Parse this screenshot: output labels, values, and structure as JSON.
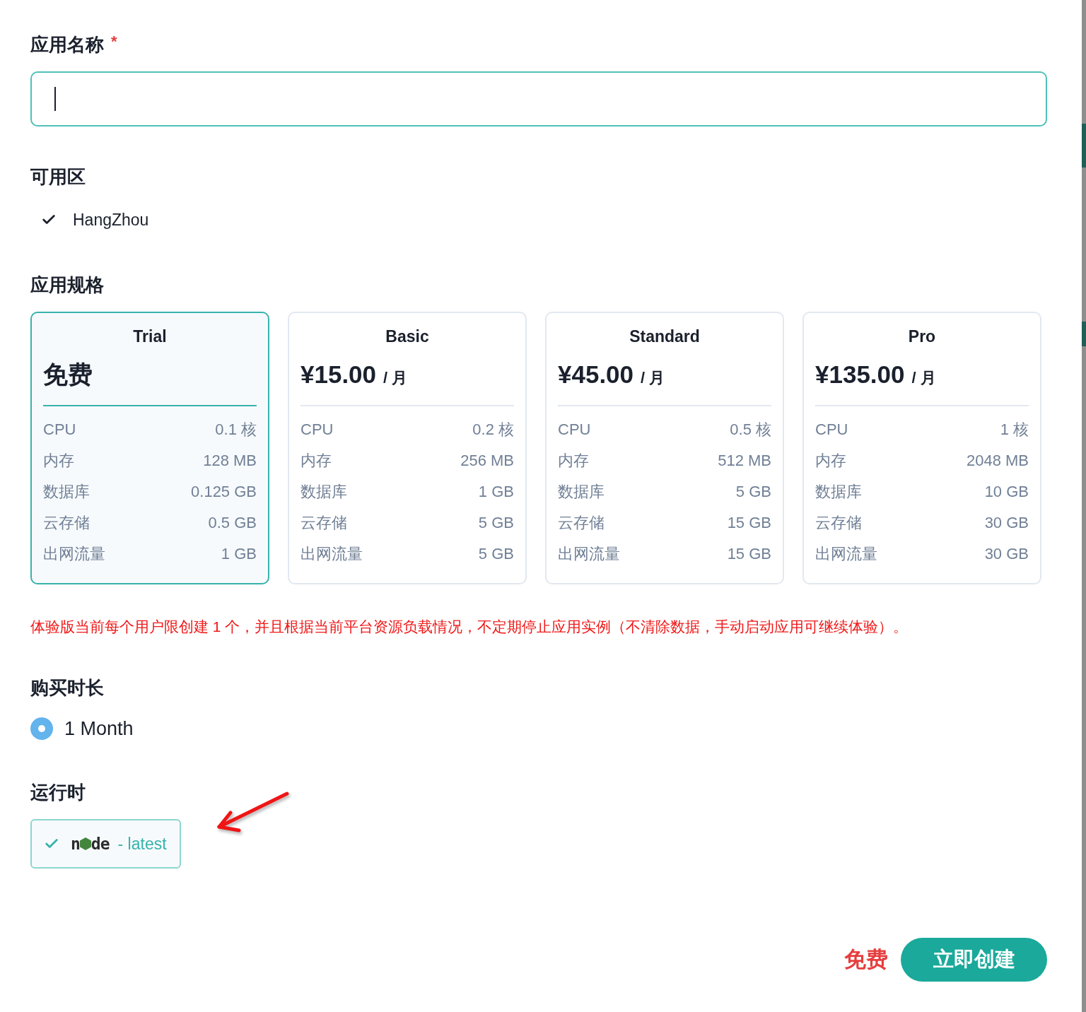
{
  "name_field": {
    "label": "应用名称",
    "required_mark": "*",
    "focused": true
  },
  "zone": {
    "label": "可用区",
    "options": [
      {
        "name": "HangZhou",
        "selected": true
      }
    ]
  },
  "plan": {
    "label": "应用规格",
    "plans": [
      {
        "name": "Trial",
        "price": "免费",
        "selected": true,
        "specs": [
          {
            "label": "CPU",
            "value": "0.1 核"
          },
          {
            "label": "内存",
            "value": "128 MB"
          },
          {
            "label": "数据库",
            "value": "0.125 GB"
          },
          {
            "label": "云存储",
            "value": "0.5 GB"
          },
          {
            "label": "出网流量",
            "value": "1 GB"
          }
        ]
      },
      {
        "name": "Basic",
        "price": "¥15.00",
        "unit": "/ 月",
        "selected": false,
        "specs": [
          {
            "label": "CPU",
            "value": "0.2 核"
          },
          {
            "label": "内存",
            "value": "256 MB"
          },
          {
            "label": "数据库",
            "value": "1 GB"
          },
          {
            "label": "云存储",
            "value": "5 GB"
          },
          {
            "label": "出网流量",
            "value": "5 GB"
          }
        ]
      },
      {
        "name": "Standard",
        "price": "¥45.00",
        "unit": "/ 月",
        "selected": false,
        "specs": [
          {
            "label": "CPU",
            "value": "0.5 核"
          },
          {
            "label": "内存",
            "value": "512 MB"
          },
          {
            "label": "数据库",
            "value": "5 GB"
          },
          {
            "label": "云存储",
            "value": "15 GB"
          },
          {
            "label": "出网流量",
            "value": "15 GB"
          }
        ]
      },
      {
        "name": "Pro",
        "price": "¥135.00",
        "unit": "/ 月",
        "selected": false,
        "specs": [
          {
            "label": "CPU",
            "value": "1 核"
          },
          {
            "label": "内存",
            "value": "2048 MB"
          },
          {
            "label": "数据库",
            "value": "10 GB"
          },
          {
            "label": "云存储",
            "value": "30 GB"
          },
          {
            "label": "出网流量",
            "value": "30 GB"
          }
        ]
      }
    ]
  },
  "notice": "体验版当前每个用户限创建 1 个，并且根据当前平台资源负载情况，不定期停止应用实例（不清除数据，手动启动应用可继续体验）。",
  "duration": {
    "label": "购买时长",
    "options": [
      {
        "name": "1 Month",
        "selected": true
      }
    ]
  },
  "runtime": {
    "label": "运行时",
    "options": [
      {
        "logo": {
          "before": "n",
          "after": "de"
        },
        "version": "- latest",
        "selected": true
      }
    ]
  },
  "footer": {
    "price": "免费",
    "submit": "立即创建"
  }
}
